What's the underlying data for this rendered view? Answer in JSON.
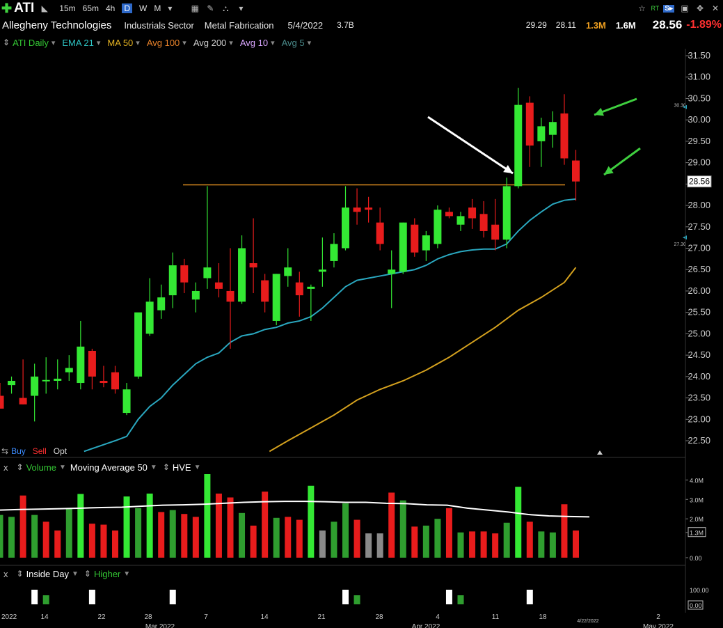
{
  "toolbar": {
    "symbol": "ATI",
    "timeframes": [
      "15m",
      "65m",
      "4h",
      "D",
      "W",
      "M"
    ],
    "active_timeframe": "D"
  },
  "info": {
    "company": "Allegheny Technologies",
    "sector": "Industrials Sector",
    "industry": "Metal Fabrication",
    "date": "5/4/2022",
    "market_cap": "3.7B",
    "high": "29.29",
    "low": "28.11",
    "volume": "1.3M",
    "avg_volume": "1.6M",
    "last": "28.56",
    "change_pct": "-1.89%"
  },
  "legend": {
    "items": [
      {
        "label": "ATI Daily",
        "color": "#34c934"
      },
      {
        "label": "EMA 21",
        "color": "#2ec4c4"
      },
      {
        "label": "MA 50",
        "color": "#e6b422"
      },
      {
        "label": "Avg 100",
        "color": "#e8822a"
      },
      {
        "label": "Avg 200",
        "color": "#cfcfcf"
      },
      {
        "label": "Avg 10",
        "color": "#d9a6ff"
      },
      {
        "label": "Avg 5",
        "color": "#4a8a8a"
      }
    ]
  },
  "trade": {
    "buy": "Buy",
    "sell": "Sell",
    "opt": "Opt"
  },
  "volume_panel": {
    "close": "x",
    "label": "Volume",
    "ma_label": "Moving Average 50",
    "hve_label": "HVE",
    "axis": [
      "4.0M",
      "3.0M",
      "2.0M",
      "1.3M",
      "0.00"
    ]
  },
  "indicator_panel": {
    "close": "x",
    "label1": "Inside Day",
    "label2": "Higher",
    "axis": [
      "100.00",
      "0.00"
    ]
  },
  "x_axis": {
    "labels": [
      "2022",
      "14",
      "22",
      "28",
      "Mar 2022",
      "7",
      "14",
      "21",
      "28",
      "4",
      "Apr 2022",
      "11",
      "18",
      "4/22/2022",
      "2",
      "May 2022"
    ]
  },
  "colors": {
    "up": "#34e834",
    "down": "#e81c1c",
    "ema21": "#2aa8c0",
    "ma50": "#d4a11e",
    "level": "#d98a1e",
    "vol_up": "#2f9e2f",
    "vol_grey": "#8a8a8a"
  },
  "chart_data": {
    "type": "candlestick",
    "symbol": "ATI",
    "period": "Daily",
    "ylim": [
      22.25,
      31.6
    ],
    "y_ticks": [
      31.5,
      31.0,
      30.5,
      30.0,
      29.5,
      29.0,
      28.5,
      28.0,
      27.5,
      27.0,
      26.5,
      26.0,
      25.5,
      25.0,
      24.5,
      24.0,
      23.5,
      23.0,
      22.5
    ],
    "last_price": 28.56,
    "ema21_label": 27.3,
    "ma50_label": 30.3,
    "resistance_level": 28.48,
    "candles": [
      {
        "o": 23.55,
        "h": 23.85,
        "l": 23.3,
        "c": 23.25
      },
      {
        "o": 23.8,
        "h": 24.0,
        "l": 23.6,
        "c": 23.9
      },
      {
        "o": 23.5,
        "h": 24.4,
        "l": 23.35,
        "c": 23.35
      },
      {
        "o": 23.55,
        "h": 24.3,
        "l": 22.95,
        "c": 24.0
      },
      {
        "o": 23.9,
        "h": 24.45,
        "l": 23.6,
        "c": 23.92
      },
      {
        "o": 23.9,
        "h": 24.4,
        "l": 23.7,
        "c": 23.95
      },
      {
        "o": 24.1,
        "h": 24.5,
        "l": 23.9,
        "c": 24.2
      },
      {
        "o": 23.85,
        "h": 25.3,
        "l": 23.7,
        "c": 24.7
      },
      {
        "o": 24.6,
        "h": 24.65,
        "l": 23.7,
        "c": 24.0
      },
      {
        "o": 23.9,
        "h": 24.25,
        "l": 23.75,
        "c": 23.85
      },
      {
        "o": 24.1,
        "h": 24.25,
        "l": 23.6,
        "c": 23.7
      },
      {
        "o": 23.15,
        "h": 23.85,
        "l": 23.1,
        "c": 23.7
      },
      {
        "o": 24.0,
        "h": 25.4,
        "l": 23.95,
        "c": 25.5
      },
      {
        "o": 25.0,
        "h": 26.3,
        "l": 24.95,
        "c": 25.75
      },
      {
        "o": 25.55,
        "h": 26.15,
        "l": 25.35,
        "c": 25.85
      },
      {
        "o": 25.9,
        "h": 26.9,
        "l": 25.6,
        "c": 26.6
      },
      {
        "o": 26.6,
        "h": 26.75,
        "l": 25.95,
        "c": 26.2
      },
      {
        "o": 25.8,
        "h": 26.2,
        "l": 25.5,
        "c": 26.0
      },
      {
        "o": 26.3,
        "h": 28.45,
        "l": 26.05,
        "c": 26.55
      },
      {
        "o": 26.2,
        "h": 26.65,
        "l": 25.85,
        "c": 26.05
      },
      {
        "o": 26.0,
        "h": 27.0,
        "l": 24.65,
        "c": 25.75
      },
      {
        "o": 25.75,
        "h": 27.3,
        "l": 25.7,
        "c": 27.0
      },
      {
        "o": 26.65,
        "h": 27.7,
        "l": 25.95,
        "c": 26.55
      },
      {
        "o": 26.25,
        "h": 26.4,
        "l": 25.5,
        "c": 25.75
      },
      {
        "o": 25.3,
        "h": 26.4,
        "l": 25.2,
        "c": 26.4
      },
      {
        "o": 26.35,
        "h": 27.0,
        "l": 26.1,
        "c": 26.55
      },
      {
        "o": 26.2,
        "h": 26.45,
        "l": 25.4,
        "c": 25.9
      },
      {
        "o": 26.05,
        "h": 26.15,
        "l": 25.3,
        "c": 26.1
      },
      {
        "o": 26.45,
        "h": 27.25,
        "l": 26.1,
        "c": 26.5
      },
      {
        "o": 26.7,
        "h": 27.35,
        "l": 26.55,
        "c": 27.1
      },
      {
        "o": 27.0,
        "h": 28.45,
        "l": 26.95,
        "c": 27.95
      },
      {
        "o": 27.95,
        "h": 28.4,
        "l": 27.55,
        "c": 27.85
      },
      {
        "o": 27.95,
        "h": 28.2,
        "l": 27.6,
        "c": 27.9
      },
      {
        "o": 27.6,
        "h": 27.95,
        "l": 26.95,
        "c": 27.1
      },
      {
        "o": 26.4,
        "h": 26.95,
        "l": 25.6,
        "c": 26.5
      },
      {
        "o": 26.45,
        "h": 27.6,
        "l": 26.4,
        "c": 27.6
      },
      {
        "o": 27.55,
        "h": 27.7,
        "l": 26.8,
        "c": 26.9
      },
      {
        "o": 26.95,
        "h": 27.4,
        "l": 26.7,
        "c": 27.3
      },
      {
        "o": 27.1,
        "h": 28.0,
        "l": 27.0,
        "c": 27.9
      },
      {
        "o": 27.85,
        "h": 27.95,
        "l": 27.7,
        "c": 27.75
      },
      {
        "o": 27.55,
        "h": 27.85,
        "l": 27.4,
        "c": 27.75
      },
      {
        "o": 27.95,
        "h": 28.15,
        "l": 27.45,
        "c": 27.7
      },
      {
        "o": 27.8,
        "h": 28.1,
        "l": 27.25,
        "c": 27.4
      },
      {
        "o": 27.55,
        "h": 28.15,
        "l": 26.95,
        "c": 27.2
      },
      {
        "o": 27.2,
        "h": 28.65,
        "l": 27.0,
        "c": 28.45
      },
      {
        "o": 28.45,
        "h": 30.75,
        "l": 28.4,
        "c": 30.35
      },
      {
        "o": 30.4,
        "h": 30.55,
        "l": 28.9,
        "c": 29.4
      },
      {
        "o": 29.5,
        "h": 30.05,
        "l": 28.9,
        "c": 29.85
      },
      {
        "o": 29.65,
        "h": 30.2,
        "l": 29.35,
        "c": 29.95
      },
      {
        "o": 30.15,
        "h": 30.6,
        "l": 28.95,
        "c": 29.1
      },
      {
        "o": 29.05,
        "h": 29.3,
        "l": 28.11,
        "c": 28.56
      }
    ],
    "ema21": [
      {
        "i": 7.3,
        "v": 22.25
      },
      {
        "i": 10,
        "v": 22.5
      },
      {
        "i": 11,
        "v": 22.6
      },
      {
        "i": 12,
        "v": 23.0
      },
      {
        "i": 13,
        "v": 23.3
      },
      {
        "i": 14,
        "v": 23.5
      },
      {
        "i": 15,
        "v": 23.8
      },
      {
        "i": 16,
        "v": 24.05
      },
      {
        "i": 17,
        "v": 24.3
      },
      {
        "i": 18,
        "v": 24.45
      },
      {
        "i": 19,
        "v": 24.55
      },
      {
        "i": 20,
        "v": 24.8
      },
      {
        "i": 21,
        "v": 24.95
      },
      {
        "i": 22,
        "v": 25.0
      },
      {
        "i": 23,
        "v": 25.1
      },
      {
        "i": 24,
        "v": 25.15
      },
      {
        "i": 25,
        "v": 25.25
      },
      {
        "i": 26,
        "v": 25.3
      },
      {
        "i": 27,
        "v": 25.4
      },
      {
        "i": 28,
        "v": 25.6
      },
      {
        "i": 29,
        "v": 25.85
      },
      {
        "i": 30,
        "v": 26.1
      },
      {
        "i": 31,
        "v": 26.25
      },
      {
        "i": 32,
        "v": 26.3
      },
      {
        "i": 33,
        "v": 26.35
      },
      {
        "i": 34,
        "v": 26.4
      },
      {
        "i": 35,
        "v": 26.45
      },
      {
        "i": 36,
        "v": 26.5
      },
      {
        "i": 37,
        "v": 26.6
      },
      {
        "i": 38,
        "v": 26.75
      },
      {
        "i": 39,
        "v": 26.85
      },
      {
        "i": 40,
        "v": 26.92
      },
      {
        "i": 41,
        "v": 26.96
      },
      {
        "i": 42,
        "v": 26.98
      },
      {
        "i": 43,
        "v": 26.98
      },
      {
        "i": 44,
        "v": 27.1
      },
      {
        "i": 45,
        "v": 27.4
      },
      {
        "i": 46,
        "v": 27.65
      },
      {
        "i": 47,
        "v": 27.85
      },
      {
        "i": 48,
        "v": 28.03
      },
      {
        "i": 49,
        "v": 28.12
      },
      {
        "i": 50,
        "v": 28.15
      }
    ],
    "ma50": [
      {
        "i": 23.4,
        "v": 22.25
      },
      {
        "i": 25,
        "v": 22.5
      },
      {
        "i": 27,
        "v": 22.8
      },
      {
        "i": 29,
        "v": 23.1
      },
      {
        "i": 31,
        "v": 23.45
      },
      {
        "i": 33,
        "v": 23.7
      },
      {
        "i": 35,
        "v": 23.9
      },
      {
        "i": 37,
        "v": 24.15
      },
      {
        "i": 39,
        "v": 24.45
      },
      {
        "i": 41,
        "v": 24.8
      },
      {
        "i": 43,
        "v": 25.15
      },
      {
        "i": 45,
        "v": 25.55
      },
      {
        "i": 47,
        "v": 25.85
      },
      {
        "i": 49,
        "v": 26.2
      },
      {
        "i": 50,
        "v": 26.55
      }
    ],
    "volume_axis_max": 4.3,
    "volumes": [
      {
        "v": 2.2,
        "d": "up"
      },
      {
        "v": 2.1,
        "d": "up"
      },
      {
        "v": 3.2,
        "d": "down"
      },
      {
        "v": 2.2,
        "d": "up"
      },
      {
        "v": 1.85,
        "d": "down"
      },
      {
        "v": 1.4,
        "d": "down"
      },
      {
        "v": 2.55,
        "d": "up"
      },
      {
        "v": 3.28,
        "d": "up"
      },
      {
        "v": 1.75,
        "d": "down"
      },
      {
        "v": 1.7,
        "d": "down"
      },
      {
        "v": 1.4,
        "d": "down"
      },
      {
        "v": 3.15,
        "d": "up"
      },
      {
        "v": 2.55,
        "d": "up"
      },
      {
        "v": 3.3,
        "d": "up"
      },
      {
        "v": 2.35,
        "d": "down"
      },
      {
        "v": 2.45,
        "d": "up"
      },
      {
        "v": 2.25,
        "d": "down"
      },
      {
        "v": 2.1,
        "d": "down"
      },
      {
        "v": 4.3,
        "d": "up"
      },
      {
        "v": 3.3,
        "d": "down"
      },
      {
        "v": 3.1,
        "d": "down"
      },
      {
        "v": 2.3,
        "d": "up"
      },
      {
        "v": 1.65,
        "d": "down"
      },
      {
        "v": 3.4,
        "d": "down"
      },
      {
        "v": 2.05,
        "d": "up"
      },
      {
        "v": 2.1,
        "d": "down"
      },
      {
        "v": 1.95,
        "d": "down"
      },
      {
        "v": 3.7,
        "d": "up"
      },
      {
        "v": 1.4,
        "d": "grey"
      },
      {
        "v": 1.85,
        "d": "up"
      },
      {
        "v": 2.8,
        "d": "up"
      },
      {
        "v": 1.95,
        "d": "down"
      },
      {
        "v": 1.25,
        "d": "grey"
      },
      {
        "v": 1.25,
        "d": "grey"
      },
      {
        "v": 3.35,
        "d": "down"
      },
      {
        "v": 2.95,
        "d": "up"
      },
      {
        "v": 1.6,
        "d": "down"
      },
      {
        "v": 1.65,
        "d": "up"
      },
      {
        "v": 2.0,
        "d": "up"
      },
      {
        "v": 2.55,
        "d": "down"
      },
      {
        "v": 1.3,
        "d": "up"
      },
      {
        "v": 1.35,
        "d": "down"
      },
      {
        "v": 1.35,
        "d": "down"
      },
      {
        "v": 1.25,
        "d": "down"
      },
      {
        "v": 1.8,
        "d": "up"
      },
      {
        "v": 3.65,
        "d": "up"
      },
      {
        "v": 1.85,
        "d": "down"
      },
      {
        "v": 1.35,
        "d": "up"
      },
      {
        "v": 1.3,
        "d": "up"
      },
      {
        "v": 2.75,
        "d": "down"
      },
      {
        "v": 1.4,
        "d": "down"
      }
    ],
    "volume_ma50": [
      2.45,
      2.48,
      2.5,
      2.52,
      2.55,
      2.58,
      2.6,
      2.65,
      2.7,
      2.72,
      2.75,
      2.8,
      2.85,
      2.88,
      2.9,
      2.9,
      2.88,
      2.85,
      2.85,
      2.8,
      2.78,
      2.72,
      2.7,
      2.55,
      2.45,
      2.35,
      2.22,
      2.15,
      2.12,
      2.1
    ],
    "inside_day_signals": [
      {
        "i": 3,
        "type": "inside"
      },
      {
        "i": 4,
        "type": "higher"
      },
      {
        "i": 8,
        "type": "inside"
      },
      {
        "i": 15,
        "type": "inside"
      },
      {
        "i": 30,
        "type": "inside"
      },
      {
        "i": 31,
        "type": "higher"
      },
      {
        "i": 39,
        "type": "inside"
      },
      {
        "i": 40,
        "type": "higher"
      },
      {
        "i": 46,
        "type": "inside"
      }
    ]
  }
}
